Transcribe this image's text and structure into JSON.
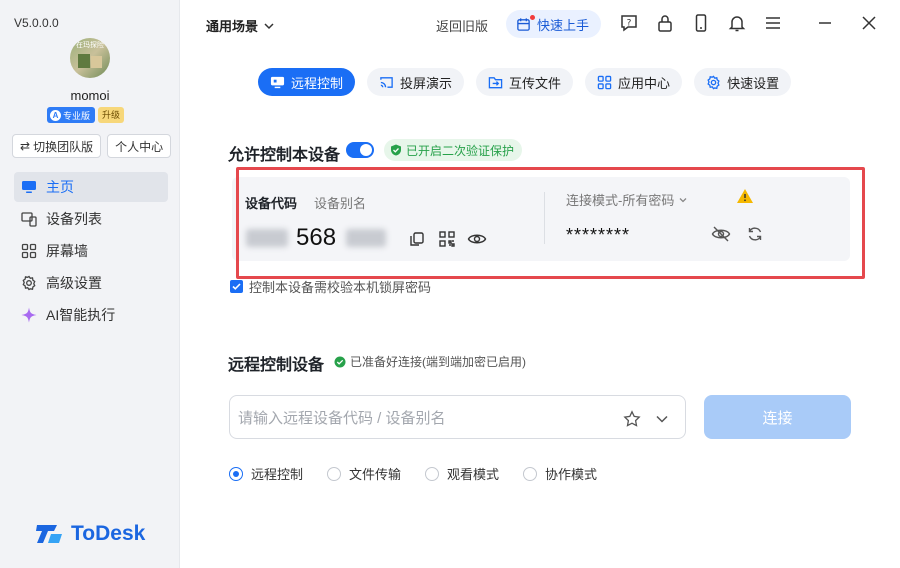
{
  "sidebar": {
    "version": "V5.0.0.0",
    "avatar_text": "在玛探险",
    "username": "momoi",
    "badge_pro": "专业版",
    "badge_upgrade": "升级",
    "switch_team": "切换团队版",
    "personal_center": "个人中心",
    "nav": [
      {
        "label": "主页",
        "icon": "monitor-icon"
      },
      {
        "label": "设备列表",
        "icon": "devices-icon"
      },
      {
        "label": "屏幕墙",
        "icon": "grid-icon"
      },
      {
        "label": "高级设置",
        "icon": "gear-icon"
      },
      {
        "label": "AI智能执行",
        "icon": "sparkle-icon"
      }
    ],
    "logo_text": "ToDesk"
  },
  "topbar": {
    "scene": "通用场景",
    "back_old": "返回旧版",
    "quick_start": "快速上手"
  },
  "tabs": [
    {
      "label": "远程控制",
      "icon": "remote-icon",
      "active": true
    },
    {
      "label": "投屏演示",
      "icon": "cast-icon",
      "active": false
    },
    {
      "label": "互传文件",
      "icon": "file-transfer-icon",
      "active": false
    },
    {
      "label": "应用中心",
      "icon": "apps-icon",
      "active": false
    },
    {
      "label": "快速设置",
      "icon": "gear-icon",
      "active": false
    }
  ],
  "allow": {
    "title": "允许控制本设备",
    "verify": "已开启二次验证保护",
    "code_label": "设备代码",
    "alias_label": "设备别名",
    "code_visible": "568",
    "conn_mode": "连接模式-所有密码",
    "password": "********",
    "lock_check": "控制本设备需校验本机锁屏密码"
  },
  "remote": {
    "title": "远程控制设备",
    "ready": "已准备好连接(端到端加密已启用)",
    "placeholder": "请输入远程设备代码 / 设备别名",
    "connect": "连接",
    "modes": [
      {
        "label": "远程控制",
        "selected": true
      },
      {
        "label": "文件传输",
        "selected": false
      },
      {
        "label": "观看模式",
        "selected": false
      },
      {
        "label": "协作模式",
        "selected": false
      }
    ]
  },
  "colors": {
    "accent": "#1a6ef5",
    "highlight_frame": "#e5484d",
    "success": "#27a14a",
    "warning": "#f5b800"
  }
}
